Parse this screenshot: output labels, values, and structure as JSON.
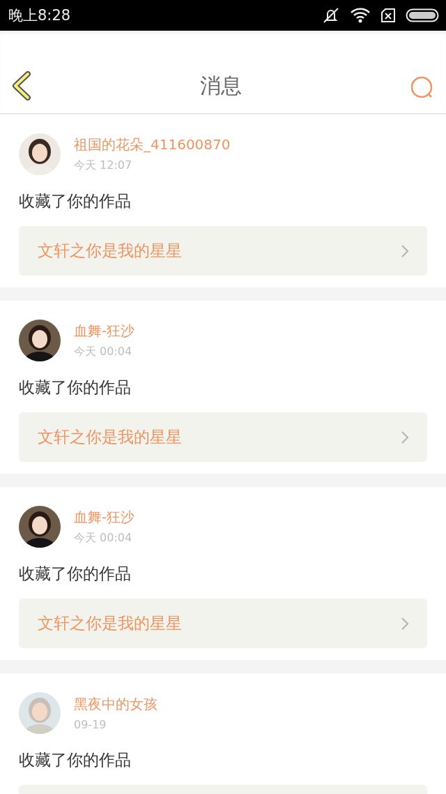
{
  "status_bar": {
    "time": "晚上8:28"
  },
  "header": {
    "title": "消息"
  },
  "messages": [
    {
      "kind": "full",
      "user": "祖国的花朵_411600870",
      "time": "今天 12:07",
      "action": "收藏了你的作品",
      "work": "文轩之你是我的星星"
    },
    {
      "kind": "full",
      "user": "血舞-狂沙",
      "time": "今天 00:04",
      "action": "收藏了你的作品",
      "work": "文轩之你是我的星星"
    },
    {
      "kind": "full",
      "user": "血舞-狂沙",
      "time": "今天 00:04",
      "action": "收藏了你的作品",
      "work": "文轩之你是我的星星"
    },
    {
      "kind": "cut",
      "user": "黑夜中的女孩",
      "time": "09-19",
      "action": "收藏了你的作品"
    }
  ]
}
